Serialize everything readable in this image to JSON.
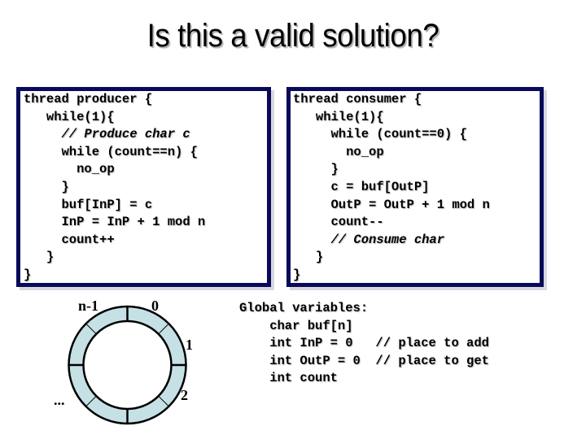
{
  "title": "Is this a valid solution?",
  "producer": {
    "lines": [
      {
        "text": "thread producer {",
        "comment": false
      },
      {
        "text": "   while(1){",
        "comment": false
      },
      {
        "text": "     // Produce char c",
        "comment": true
      },
      {
        "text": "     while (count==n) {",
        "comment": false
      },
      {
        "text": "       no_op",
        "comment": false
      },
      {
        "text": "     }",
        "comment": false
      },
      {
        "text": "     buf[InP] = c",
        "comment": false
      },
      {
        "text": "     InP = InP + 1 mod n",
        "comment": false
      },
      {
        "text": "     count++",
        "comment": false
      },
      {
        "text": "   }",
        "comment": false
      },
      {
        "text": "}",
        "comment": false
      }
    ]
  },
  "consumer": {
    "lines": [
      {
        "text": "thread consumer {",
        "comment": false
      },
      {
        "text": "   while(1){",
        "comment": false
      },
      {
        "text": "     while (count==0) {",
        "comment": false
      },
      {
        "text": "       no_op",
        "comment": false
      },
      {
        "text": "     }",
        "comment": false
      },
      {
        "text": "     c = buf[OutP]",
        "comment": false
      },
      {
        "text": "     OutP = OutP + 1 mod n",
        "comment": false
      },
      {
        "text": "     count--",
        "comment": false
      },
      {
        "text": "     // Consume char",
        "comment": true
      },
      {
        "text": "   }",
        "comment": false
      },
      {
        "text": "}",
        "comment": false
      }
    ]
  },
  "globals": {
    "lines": [
      "Global variables:",
      "    char buf[n]",
      "    int InP = 0   // place to add",
      "    int OutP = 0  // place to get",
      "    int count"
    ]
  },
  "ring_buffer": {
    "labels": {
      "last": "n-1",
      "first": "0",
      "second": "1",
      "third": "2",
      "ellipsis": "..."
    },
    "slots": 8,
    "fill_color": "#c5e1e6",
    "stroke_color": "#000000"
  },
  "colors": {
    "box_border": "#0a0a5a"
  }
}
